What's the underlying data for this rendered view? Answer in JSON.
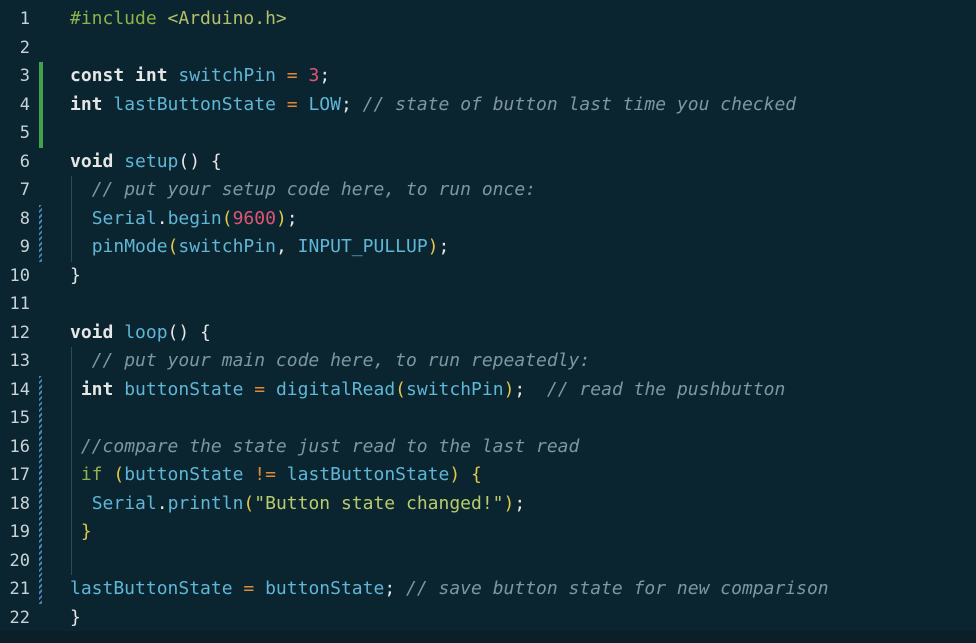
{
  "editor": {
    "lines": [
      {
        "n": "1",
        "tokens": [
          {
            "c": "kw-inc",
            "t": "#include "
          },
          {
            "c": "inc-str",
            "t": "<Arduino.h>"
          }
        ]
      },
      {
        "n": "2",
        "tokens": []
      },
      {
        "n": "3",
        "tokens": [
          {
            "c": "kw",
            "t": "const "
          },
          {
            "c": "kw",
            "t": "int "
          },
          {
            "c": "var",
            "t": "switchPin"
          },
          {
            "c": "plain",
            "t": " "
          },
          {
            "c": "op",
            "t": "="
          },
          {
            "c": "plain",
            "t": " "
          },
          {
            "c": "num",
            "t": "3"
          },
          {
            "c": "plain",
            "t": ";"
          }
        ]
      },
      {
        "n": "4",
        "tokens": [
          {
            "c": "kw",
            "t": "int "
          },
          {
            "c": "var",
            "t": "lastButtonState"
          },
          {
            "c": "plain",
            "t": " "
          },
          {
            "c": "op",
            "t": "="
          },
          {
            "c": "plain",
            "t": " "
          },
          {
            "c": "var",
            "t": "LOW"
          },
          {
            "c": "plain",
            "t": "; "
          },
          {
            "c": "cm",
            "t": "// state of button last time you checked"
          }
        ]
      },
      {
        "n": "5",
        "tokens": []
      },
      {
        "n": "6",
        "tokens": [
          {
            "c": "kw",
            "t": "void "
          },
          {
            "c": "fn",
            "t": "setup"
          },
          {
            "c": "plain",
            "t": "() {"
          }
        ]
      },
      {
        "n": "7",
        "tokens": [
          {
            "c": "plain",
            "t": "  "
          },
          {
            "c": "cm",
            "t": "// put your setup code here, to run once:"
          }
        ]
      },
      {
        "n": "8",
        "tokens": [
          {
            "c": "plain",
            "t": "  "
          },
          {
            "c": "var",
            "t": "Serial"
          },
          {
            "c": "plain",
            "t": "."
          },
          {
            "c": "fn",
            "t": "begin"
          },
          {
            "c": "punc",
            "t": "("
          },
          {
            "c": "num",
            "t": "9600"
          },
          {
            "c": "punc",
            "t": ")"
          },
          {
            "c": "plain",
            "t": ";"
          }
        ]
      },
      {
        "n": "9",
        "tokens": [
          {
            "c": "plain",
            "t": "  "
          },
          {
            "c": "fn",
            "t": "pinMode"
          },
          {
            "c": "punc",
            "t": "("
          },
          {
            "c": "var",
            "t": "switchPin"
          },
          {
            "c": "plain",
            "t": ", "
          },
          {
            "c": "var",
            "t": "INPUT_PULLUP"
          },
          {
            "c": "punc",
            "t": ")"
          },
          {
            "c": "plain",
            "t": ";"
          }
        ]
      },
      {
        "n": "10",
        "tokens": [
          {
            "c": "plain",
            "t": "}"
          }
        ]
      },
      {
        "n": "11",
        "tokens": []
      },
      {
        "n": "12",
        "tokens": [
          {
            "c": "kw",
            "t": "void "
          },
          {
            "c": "fn",
            "t": "loop"
          },
          {
            "c": "plain",
            "t": "() {"
          }
        ]
      },
      {
        "n": "13",
        "tokens": [
          {
            "c": "plain",
            "t": "  "
          },
          {
            "c": "cm",
            "t": "// put your main code here, to run repeatedly:"
          }
        ]
      },
      {
        "n": "14",
        "tokens": [
          {
            "c": "plain",
            "t": " "
          },
          {
            "c": "kw",
            "t": "int "
          },
          {
            "c": "var",
            "t": "buttonState"
          },
          {
            "c": "plain",
            "t": " "
          },
          {
            "c": "op",
            "t": "="
          },
          {
            "c": "plain",
            "t": " "
          },
          {
            "c": "fn",
            "t": "digitalRead"
          },
          {
            "c": "punc",
            "t": "("
          },
          {
            "c": "var",
            "t": "switchPin"
          },
          {
            "c": "punc",
            "t": ")"
          },
          {
            "c": "plain",
            "t": ";  "
          },
          {
            "c": "cm",
            "t": "// read the pushbutton"
          }
        ]
      },
      {
        "n": "15",
        "tokens": []
      },
      {
        "n": "16",
        "tokens": [
          {
            "c": "plain",
            "t": " "
          },
          {
            "c": "cm",
            "t": "//compare the state just read to the last read"
          }
        ]
      },
      {
        "n": "17",
        "tokens": [
          {
            "c": "plain",
            "t": " "
          },
          {
            "c": "kw-inc",
            "t": "if "
          },
          {
            "c": "punc",
            "t": "("
          },
          {
            "c": "var",
            "t": "buttonState"
          },
          {
            "c": "plain",
            "t": " "
          },
          {
            "c": "op",
            "t": "!="
          },
          {
            "c": "plain",
            "t": " "
          },
          {
            "c": "var",
            "t": "lastButtonState"
          },
          {
            "c": "punc",
            "t": ")"
          },
          {
            "c": "plain",
            "t": " "
          },
          {
            "c": "punc",
            "t": "{"
          }
        ]
      },
      {
        "n": "18",
        "tokens": [
          {
            "c": "plain",
            "t": "  "
          },
          {
            "c": "var",
            "t": "Serial"
          },
          {
            "c": "plain",
            "t": "."
          },
          {
            "c": "fn",
            "t": "println"
          },
          {
            "c": "punc",
            "t": "("
          },
          {
            "c": "str",
            "t": "\"Button state changed!\""
          },
          {
            "c": "punc",
            "t": ")"
          },
          {
            "c": "plain",
            "t": ";"
          }
        ]
      },
      {
        "n": "19",
        "tokens": [
          {
            "c": "plain",
            "t": " "
          },
          {
            "c": "punc",
            "t": "}"
          }
        ]
      },
      {
        "n": "20",
        "tokens": []
      },
      {
        "n": "21",
        "tokens": [
          {
            "c": "var",
            "t": "lastButtonState"
          },
          {
            "c": "plain",
            "t": " "
          },
          {
            "c": "op",
            "t": "="
          },
          {
            "c": "plain",
            "t": " "
          },
          {
            "c": "var",
            "t": "buttonState"
          },
          {
            "c": "plain",
            "t": "; "
          },
          {
            "c": "cm",
            "t": "// save button state for new comparison"
          }
        ]
      },
      {
        "n": "22",
        "tokens": [
          {
            "c": "plain",
            "t": "}"
          }
        ]
      }
    ],
    "gutter_green_lines": [
      3,
      4,
      5
    ],
    "gutter_blue_lines": [
      8,
      9,
      14,
      15,
      16,
      17,
      18,
      19,
      20,
      21
    ]
  }
}
